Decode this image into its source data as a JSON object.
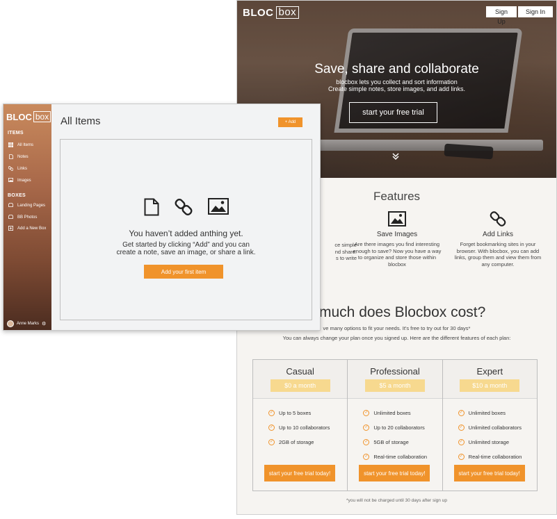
{
  "landing": {
    "logo": {
      "bold": "BLOC",
      "boxed": "box"
    },
    "header": {
      "signup_label": "Sign Up",
      "signin_label": "Sign In"
    },
    "hero": {
      "title": "Save, share and collaborate",
      "subtitle1": "blocbox lets you collect and sort information",
      "subtitle2": "Create simple notes, store images, and add links.",
      "cta_label": "start your free trial",
      "scroll_icon": "double-chevron-down-icon"
    },
    "features": {
      "title": "Features",
      "items": [
        {
          "icon": "note-icon",
          "title": "",
          "desc": "ce simple\nnd share.\ns to write"
        },
        {
          "icon": "image-icon",
          "title": "Save Images",
          "desc": "Are there images you find interesting enough to save? Now you have a way to organize and store those within blocbox"
        },
        {
          "icon": "link-icon",
          "title": "Add Links",
          "desc": "Forget bookmarking sites in your browser. With blocbox, you can add links, group them and view them from any computer."
        }
      ]
    },
    "pricing": {
      "title": "v much does Blocbox cost?",
      "sub1": "ve many options to fit your needs. It's free to try out for 30 days*",
      "sub2": "You can always change your plan once you signed up. Here are the different features of each plan:",
      "plans": [
        {
          "name": "Casual",
          "price": "$0 a month",
          "features": [
            "Up to 5 boxes",
            "Up to 10 collaborators",
            "2GB of storage"
          ],
          "cta": "start your free trial today!"
        },
        {
          "name": "Professional",
          "price": "$5 a month",
          "features": [
            "Unlimited boxes",
            "Up to 20 collaborators",
            "5GB of storage",
            "Real-time collaboration"
          ],
          "cta": "start your free trial today!"
        },
        {
          "name": "Expert",
          "price": "$10 a month",
          "features": [
            "Unlimited boxes",
            "Unlimited collaborators",
            "Unlimited storage",
            "Real-time collaboration"
          ],
          "cta": "start your free trial today!"
        }
      ],
      "footnote": "*you will not be charged until 30 days after sign up"
    }
  },
  "app": {
    "logo": {
      "bold": "BLOC",
      "boxed": "box"
    },
    "sidebar": {
      "items_heading": "ITEMS",
      "items": [
        {
          "icon": "grid-icon",
          "label": "All Items"
        },
        {
          "icon": "note-icon",
          "label": "Notes"
        },
        {
          "icon": "link-icon",
          "label": "Links"
        },
        {
          "icon": "image-icon",
          "label": "Images"
        }
      ],
      "boxes_heading": "BOXES",
      "boxes": [
        {
          "icon": "box-icon",
          "label": "Landing Pages"
        },
        {
          "icon": "box-icon",
          "label": "BB Photos"
        },
        {
          "icon": "plus-box-icon",
          "label": "Add a New Box"
        }
      ],
      "user": {
        "name": "Anne Marks",
        "settings_icon": "gear-icon"
      }
    },
    "main": {
      "title": "All Items",
      "add_label": "+ Add",
      "empty": {
        "heading": "You haven’t added anthing yet.",
        "line1": "Get started by clicking “Add” and you can",
        "line2": "create a note, save an image, or share a link.",
        "button": "Add your first item"
      }
    }
  },
  "colors": {
    "accent": "#f0932b",
    "price_tag": "#f7d98f",
    "sidebar_top": "#c98a5d",
    "sidebar_bottom": "#4b2c20"
  }
}
